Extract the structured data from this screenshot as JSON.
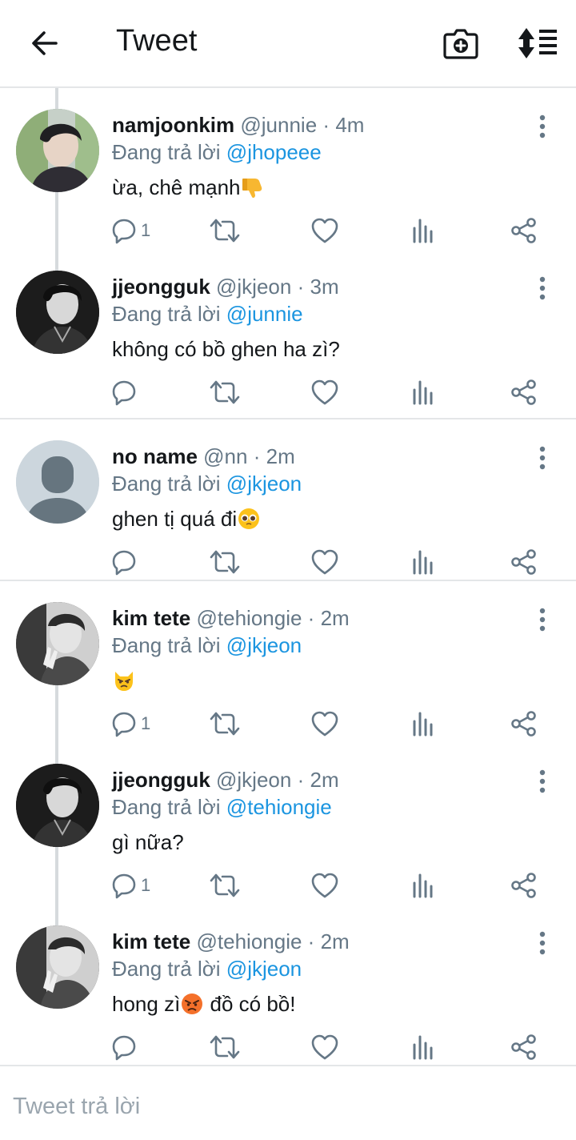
{
  "header": {
    "title": "Tweet",
    "icons": [
      "back-arrow-icon",
      "camera-plus-icon",
      "sort-icon"
    ]
  },
  "reply_prefix": "Đang trả lời",
  "tweets": [
    {
      "name": "namjoonkim",
      "handle": "@junnie",
      "time": "4m",
      "reply_to": "@jhopeee",
      "text": "ừa, chê mạnh",
      "emoji": "thumbs-down",
      "reply_count": "1"
    },
    {
      "name": "jjeongguk",
      "handle": "@jkjeon",
      "time": "3m",
      "reply_to": "@junnie",
      "text": "không có bồ ghen ha zì?",
      "emoji": "",
      "reply_count": ""
    },
    {
      "name": "no name",
      "handle": "@nn",
      "time": "2m",
      "reply_to": "@jkjeon",
      "text": "ghen tị quá đi",
      "emoji": "pleading-face",
      "reply_count": ""
    },
    {
      "name": "kim tete",
      "handle": "@tehiongie",
      "time": "2m",
      "reply_to": "@jkjeon",
      "text": "",
      "emoji": "pouting-cat",
      "reply_count": "1"
    },
    {
      "name": "jjeongguk",
      "handle": "@jkjeon",
      "time": "2m",
      "reply_to": "@tehiongie",
      "text": "gì nữa?",
      "emoji": "",
      "reply_count": "1"
    },
    {
      "name": "kim tete",
      "handle": "@tehiongie",
      "time": "2m",
      "reply_to": "@jkjeon",
      "text_before": "hong zì",
      "emoji": "angry-face",
      "text_after": " đồ có bồ!",
      "reply_count": ""
    }
  ],
  "compose": {
    "placeholder": "Tweet trả lời"
  },
  "colors": {
    "link": "#1b95e0",
    "muted": "#657786",
    "divider": "#e4e6e8"
  }
}
